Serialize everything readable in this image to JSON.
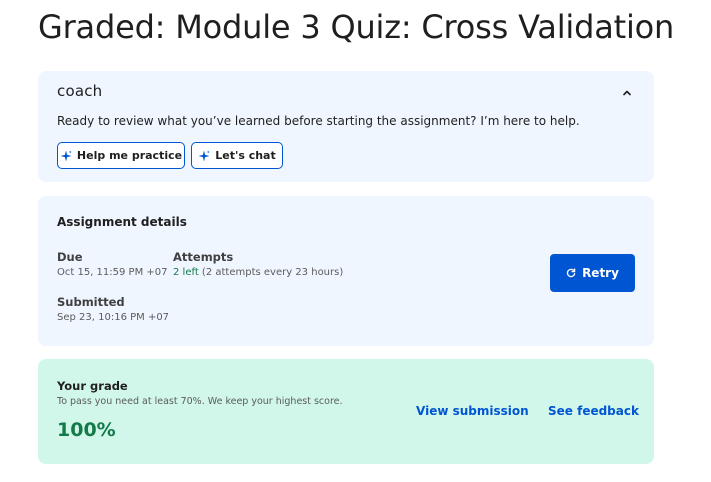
{
  "page": {
    "title": "Graded: Module 3 Quiz: Cross Validation"
  },
  "coach": {
    "logo_text": "coach",
    "collapse_icon": "chevron-up-icon",
    "prompt": "Ready to review what you’ve learned before starting the assignment? I’m here to help.",
    "buttons": [
      {
        "label": "Help me practice",
        "icon": "sparkle-icon"
      },
      {
        "label": "Let's chat",
        "icon": "sparkle-icon"
      }
    ]
  },
  "assignment": {
    "heading": "Assignment details",
    "due_label": "Due",
    "due_value": "Oct 15, 11:59 PM +07",
    "attempts_label": "Attempts",
    "attempts_left": "2 left",
    "attempts_detail": " (2 attempts every 23 hours)",
    "submitted_label": "Submitted",
    "submitted_value": "Sep 23, 10:16 PM +07",
    "retry_label": "Retry",
    "retry_icon": "refresh-icon"
  },
  "grade": {
    "heading": "Your grade",
    "subtext": "To pass you need at least 70%. We keep your highest score.",
    "value": "100%",
    "view_submission_label": "View submission",
    "see_feedback_label": "See feedback"
  },
  "colors": {
    "primary_blue": "#0056d2",
    "card_blue_bg": "#f0f6ff",
    "grade_bg": "#d1f7ea",
    "success_green": "#137a4a"
  }
}
